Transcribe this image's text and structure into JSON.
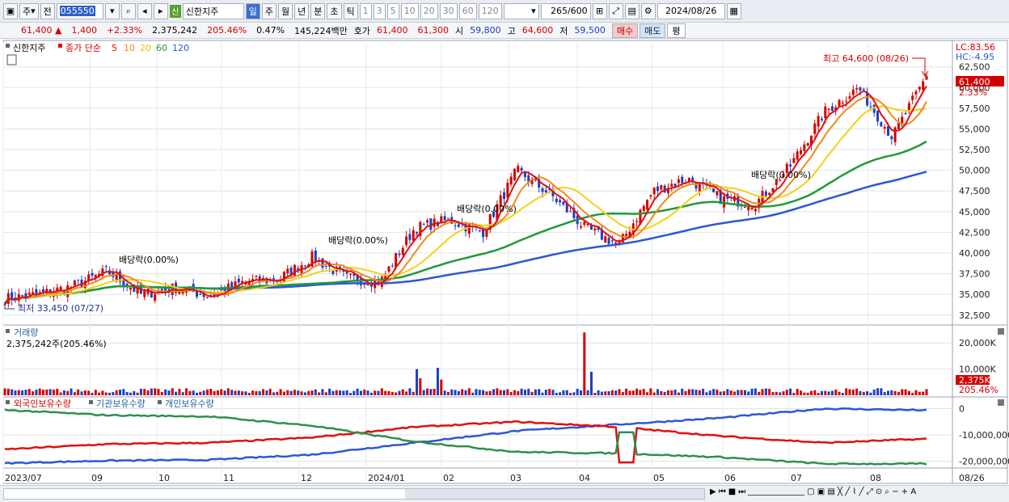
{
  "toolbar": {
    "type_label": "주",
    "scope_label": "전",
    "code": "055550",
    "stock_name": "신한지주",
    "badge": "신",
    "periods": [
      "일",
      "주",
      "월",
      "년",
      "분",
      "초",
      "틱"
    ],
    "active_period": "일",
    "intervals": [
      "1",
      "3",
      "5",
      "10",
      "20",
      "30",
      "60",
      "120"
    ],
    "count": "265",
    "count_total": "/600",
    "date": "2024/08/26"
  },
  "quote": {
    "price": "61,400",
    "arrow": "▲",
    "change": "1,400",
    "change_pct": "+2.33%",
    "volume": "2,375,242",
    "volume_ratio": "205.46%",
    "turnover": "0.47%",
    "amount": "145,224백만",
    "hoga_label": "호가",
    "ask": "61,400",
    "bid": "61,300",
    "open_label": "시",
    "open": "59,800",
    "high_label": "고",
    "high": "64,600",
    "low_label": "저",
    "low": "59,500",
    "buy_label": "매수",
    "sell_label": "매도",
    "eval_label": "평"
  },
  "price_panel": {
    "stock_tag": "신한지주",
    "ma_label": "종가 단순",
    "ma_periods": [
      "5",
      "10",
      "20",
      "60",
      "120"
    ],
    "lc": "LC:83.56",
    "hc": "HC:-4.95",
    "current_price_tag": "61,400",
    "current_pct": "2.33%",
    "max_note": "최고 64,600 (08/26)",
    "min_note": "최저 33,450 (07/27)",
    "dividend_note": "배당락(0.00%)"
  },
  "volume_panel": {
    "title": "거래량",
    "value": "2,375,242주(205.46%)",
    "tag_value": "2,375K",
    "tag_pct": "205.46%"
  },
  "holding_panel": {
    "series": [
      "외국인보유수량",
      "기관보유수량",
      "개인보유수량"
    ]
  },
  "x_labels": [
    "2023/07",
    "09",
    "10",
    "11",
    "12",
    "2024/01",
    "02",
    "03",
    "04",
    "05",
    "06",
    "07",
    "08",
    "08/26"
  ],
  "colors": {
    "up": "#d40000",
    "down": "#1f3fbf",
    "ma5": "#e01010",
    "ma10": "#f08a1c",
    "ma20": "#f2d21a",
    "ma60": "#1f9a3a",
    "ma120": "#2e56d8",
    "foreign": "#2e56d8",
    "institution": "#e01010",
    "individual": "#2f8f4e"
  },
  "chart_data": [
    {
      "type": "candlestick",
      "title": "신한지주",
      "ylim": [
        31500,
        65500
      ],
      "yticks": [
        "62,500",
        "60,000",
        "57,500",
        "55,000",
        "52,500",
        "50,000",
        "47,500",
        "45,000",
        "42,500",
        "40,000",
        "37,500",
        "35,000",
        "32,500"
      ],
      "close_anchors": [
        {
          "x": "2023/07",
          "y": 34500
        },
        {
          "x": "2023/08",
          "y": 35000
        },
        {
          "x": "2023/09",
          "y": 36000
        },
        {
          "x": "2023/09 late",
          "y": 37800
        },
        {
          "x": "2023/10",
          "y": 35000
        },
        {
          "x": "2023/10 mid",
          "y": 35800
        },
        {
          "x": "2023/11",
          "y": 34800
        },
        {
          "x": "2023/11 late",
          "y": 36500
        },
        {
          "x": "2023/12",
          "y": 36800
        },
        {
          "x": "2023/12 late",
          "y": 39500
        },
        {
          "x": "2024/01",
          "y": 37000
        },
        {
          "x": "2024/01 late",
          "y": 36500
        },
        {
          "x": "2024/02",
          "y": 43000
        },
        {
          "x": "2024/02 late",
          "y": 44000
        },
        {
          "x": "2024/03",
          "y": 42500
        },
        {
          "x": "2024/03 mid",
          "y": 50000
        },
        {
          "x": "2024/04",
          "y": 47000
        },
        {
          "x": "2024/04 mid",
          "y": 43000
        },
        {
          "x": "2024/04 late",
          "y": 41000
        },
        {
          "x": "2024/05",
          "y": 47500
        },
        {
          "x": "2024/05 late",
          "y": 49000
        },
        {
          "x": "2024/06",
          "y": 46500
        },
        {
          "x": "2024/06 late",
          "y": 46000
        },
        {
          "x": "2024/07",
          "y": 50500
        },
        {
          "x": "2024/07 late",
          "y": 57000
        },
        {
          "x": "2024/08 start",
          "y": 60000
        },
        {
          "x": "2024/08",
          "y": 54000
        },
        {
          "x": "2024/08/26",
          "y": 61400
        }
      ],
      "moving_averages": [
        "5",
        "10",
        "20",
        "60",
        "120"
      ]
    },
    {
      "type": "bar",
      "title": "거래량",
      "ylim": [
        0,
        25000
      ],
      "yticks": [
        "20,000K",
        "10,000K"
      ],
      "unit": "K shares",
      "spikes": [
        {
          "x": "2024/02",
          "y": 10000
        },
        {
          "x": "2024/03",
          "y": 10500
        },
        {
          "x": "2024/03 late",
          "y": 24000
        }
      ],
      "last": 2375
    },
    {
      "type": "line",
      "title": "외국인/기관/개인 보유수량",
      "ylim": [
        -22000000,
        2000000
      ],
      "yticks": [
        "0",
        "-10,000,000",
        "-20,000,000"
      ],
      "series": [
        {
          "name": "외국인보유수량",
          "anchors": [
            -20800000,
            -19800000,
            -19500000,
            -17500000,
            -13000000,
            -8500000,
            -6000000,
            -3500000,
            0,
            -600000
          ]
        },
        {
          "name": "기관보유수량",
          "anchors": [
            -15500000,
            -13500000,
            -13000000,
            -11000000,
            -7000000,
            -5000000,
            -7000000,
            -10500000,
            -13000000,
            -11500000
          ]
        },
        {
          "name": "개인보유수량",
          "anchors": [
            -500000,
            -2500000,
            -3000000,
            -6500000,
            -12500000,
            -16500000,
            -17000000,
            -18500000,
            -21000000,
            -21000000
          ]
        }
      ]
    }
  ]
}
